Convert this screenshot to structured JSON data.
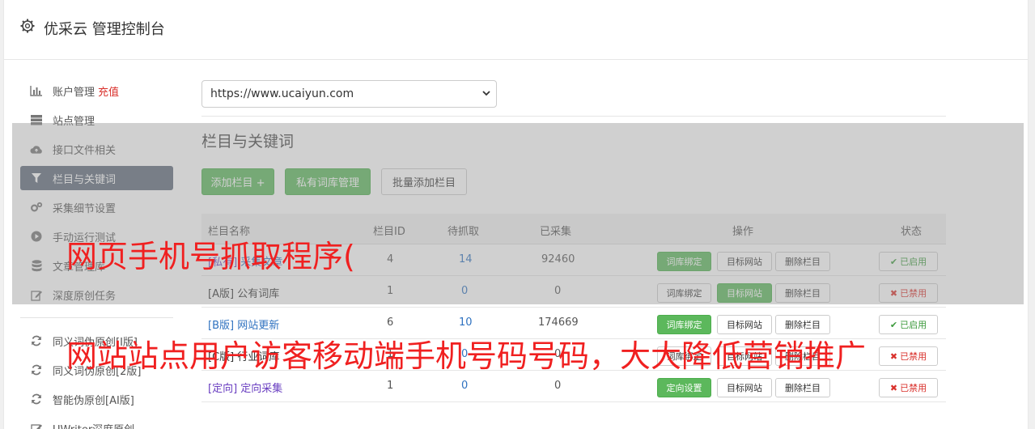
{
  "header": {
    "title": "优采云 管理控制台"
  },
  "sidebar": {
    "items": [
      {
        "label": "账户管理",
        "extra": "充值",
        "icon": "bar-chart-icon"
      },
      {
        "label": "站点管理",
        "icon": "server-icon"
      },
      {
        "label": "接口文件相关",
        "icon": "cloud-upload-icon"
      },
      {
        "label": "栏目与关键词",
        "icon": "filter-icon"
      },
      {
        "label": "采集细节设置",
        "icon": "cogs-icon"
      },
      {
        "label": "手动运行测试",
        "icon": "play-circle-icon"
      },
      {
        "label": "文章管理库",
        "icon": "database-icon"
      },
      {
        "label": "深度原创任务",
        "icon": "edit-icon"
      },
      {
        "label": "同义词伪原创[I版]",
        "icon": "refresh-icon"
      },
      {
        "label": "同义词伪原创[2版]",
        "icon": "refresh-icon"
      },
      {
        "label": "智能伪原创[AI版]",
        "icon": "refresh-icon"
      },
      {
        "label": "UWriter深度原创",
        "icon": "edit-icon"
      }
    ]
  },
  "site_select": {
    "value": "https://www.ucaiyun.com"
  },
  "section": {
    "title": "栏目与关键词",
    "add_button": "添加栏目 +",
    "private_lib_button": "私有词库管理",
    "batch_add_button": "批量添加栏目"
  },
  "table": {
    "headers": [
      "栏目名称",
      "栏目ID",
      "待抓取",
      "已采集",
      "操作",
      "状态"
    ],
    "rows": [
      {
        "tag": "[私有]",
        "name": "采集文章",
        "id": "4",
        "pending": "14",
        "collected": "92460",
        "op1": "词库绑定",
        "op2": "目标网站",
        "op3": "删除栏目",
        "status": "已启用"
      },
      {
        "tag": "[A版]",
        "name": "公有词库",
        "id": "1",
        "pending": "0",
        "collected": "0",
        "op1": "词库绑定",
        "op2": "目标网站",
        "op3": "删除栏目",
        "status": "已禁用"
      },
      {
        "tag": "[B版]",
        "name": "网站更新",
        "id": "6",
        "pending": "10",
        "collected": "174669",
        "op1": "词库绑定",
        "op2": "目标网站",
        "op3": "删除栏目",
        "status": "已启用"
      },
      {
        "tag": "[C版]",
        "name": "行业词库",
        "id": "1",
        "pending": "0",
        "collected": "0",
        "op1": "词库绑定",
        "op2": "目标网站",
        "op3": "删除栏目",
        "status": "已禁用"
      },
      {
        "tag": "[定向]",
        "name": "定向采集",
        "id": "1",
        "pending": "0",
        "collected": "0",
        "op1": "定向设置",
        "op2": "目标网站",
        "op3": "删除栏目",
        "status": "已禁用"
      }
    ]
  },
  "watermark": {
    "line1": "网页手机号抓取程序(",
    "line2": "网站站点用户访客移动端手机号码号码，大大降低营销推广"
  }
}
